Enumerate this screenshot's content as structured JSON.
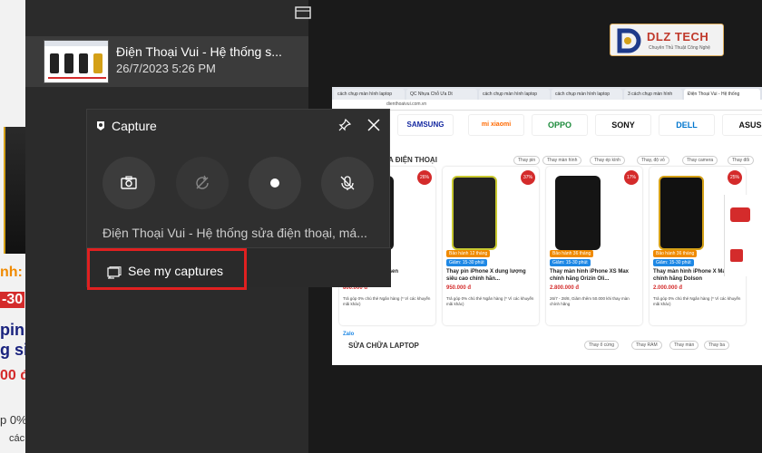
{
  "background_page": {
    "lines": [
      "nh: 1",
      "-30",
      "pin",
      "g siê",
      "00 đ",
      "p 0%",
      "các"
    ]
  },
  "game_bar": {
    "recent_capture": {
      "title": "Điện Thoại Vui - Hệ thống s...",
      "date": "26/7/2023 5:26 PM"
    }
  },
  "logo": {
    "text": "DLZ TECH",
    "tagline": "Chuyên Thủ Thuật Công Nghệ"
  },
  "capture_widget": {
    "title": "Capture",
    "buttons": [
      "screenshot-button",
      "record-last-30s-button",
      "start-recording-button",
      "microphone-toggle-button"
    ],
    "description": "Điện Thoại Vui - Hệ thống sửa điện thoại, má...",
    "see_captures_label": "See my captures",
    "highlight_color": "#e02020"
  },
  "screenshot": {
    "tabs": [
      "cách chụp màn hình laptop",
      "QC Nhựa Chỗ Ưa Dt",
      "cách chụp màn hình laptop",
      "cách chụp màn hình laptop",
      "3 cách chụp màn hình",
      "Điện Thoại Vui - Hệ thống"
    ],
    "url": "dienthoaivui.com.vn",
    "brands": [
      "SAMSUNG",
      "mi xiaomi",
      "OPPO",
      "SONY",
      "DELL",
      "ASUS"
    ],
    "section1_title": "A ĐIỆN THOẠI",
    "section1_chips": [
      "Thay pin",
      "Thay màn hình",
      "Thay ép kính",
      "Thay, độ vỏ",
      "Thay camera",
      "Thay đổi"
    ],
    "cards": [
      {
        "badge": "26%",
        "tag": "",
        "tag2": "",
        "name": "7 Plus\nsiêu cao Pisen",
        "price": "800.000 đ",
        "note": "Trả góp 0% chủ thẻ Ngân hàng (* Vì các khuyến mãi khác)"
      },
      {
        "badge": "37%",
        "tag": "Bảo hành 12 tháng",
        "tag2": "Giảm: 15-30 phút",
        "name": "Thay pin iPhone X dung lượng siêu cao chính hãn...",
        "price": "950.000 đ",
        "note": "Trả góp 0% chủ thẻ Ngân hàng (* Vì các khuyến mãi khác)"
      },
      {
        "badge": "17%",
        "tag": "Bảo hành 36 tháng",
        "tag2": "Giảm: 15-30 phút",
        "name": "Thay màn hình iPhone XS Max chính hãng Orizin Oli...",
        "price": "2.800.000 đ",
        "note": "26/7 - 28/8, Giảm thêm 50.000 khi thay màn chính hãng"
      },
      {
        "badge": "25%",
        "tag": "Bảo hành 36 tháng",
        "tag2": "Giảm: 15-30 phút",
        "name": "Thay màn hình iPhone X Max chính hãng Dolson",
        "price": "2.000.000 đ",
        "note": "Trả góp 0% chủ thẻ Ngân hàng (* Vì các khuyến mãi khác)"
      }
    ],
    "section2_title": "SỬA CHỮA LAPTOP",
    "section2_chips": [
      "Thay ổ cứng",
      "Thay RAM",
      "Thay màn",
      "Thay ba"
    ],
    "zalo": "Zalo"
  }
}
